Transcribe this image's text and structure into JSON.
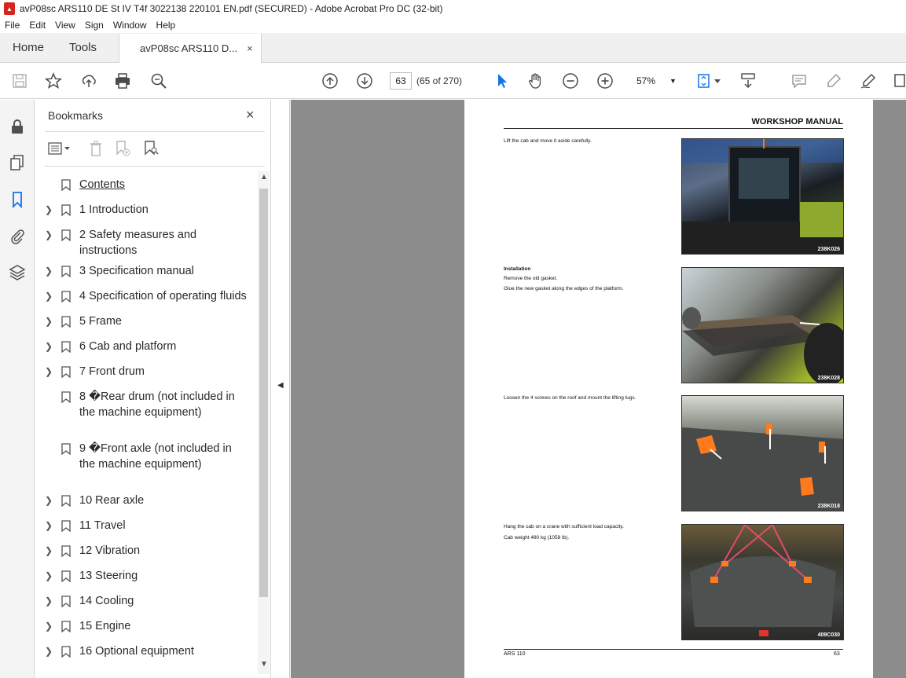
{
  "window": {
    "title": "avP08sc ARS110 DE St IV T4f 3022138 220101 EN.pdf (SECURED) - Adobe Acrobat Pro DC (32-bit)"
  },
  "menu": [
    "File",
    "Edit",
    "View",
    "Sign",
    "Window",
    "Help"
  ],
  "tabs": {
    "home": "Home",
    "tools": "Tools",
    "document": "avP08sc ARS110 D...",
    "close": "×"
  },
  "toolbar": {
    "page_number": "63",
    "page_count": "(65 of 270)",
    "zoom": "57%"
  },
  "bookmarks": {
    "title": "Bookmarks",
    "close": "×",
    "items": [
      {
        "label": "Contents",
        "expandable": false
      },
      {
        "label": "1 Introduction",
        "expandable": true
      },
      {
        "label": "2 Safety measures and instructions",
        "expandable": true
      },
      {
        "label": "3 Specification manual",
        "expandable": true
      },
      {
        "label": "4 Specification of operating fluids",
        "expandable": true
      },
      {
        "label": "5 Frame",
        "expandable": true
      },
      {
        "label": "6 Cab and platform",
        "expandable": true
      },
      {
        "label": "7 Front drum",
        "expandable": true
      },
      {
        "label": "8 �Rear drum (not included in the machine equipment)",
        "expandable": false
      },
      {
        "label": "9 �Front axle (not included in the machine equipment)",
        "expandable": false
      },
      {
        "label": "10 Rear axle",
        "expandable": true
      },
      {
        "label": "11 Travel",
        "expandable": true
      },
      {
        "label": "12 Vibration",
        "expandable": true
      },
      {
        "label": "13 Steering",
        "expandable": true
      },
      {
        "label": "14 Cooling",
        "expandable": true
      },
      {
        "label": "15 Engine",
        "expandable": true
      },
      {
        "label": "16 Optional equipment",
        "expandable": true
      }
    ]
  },
  "page": {
    "header": "WORKSHOP MANUAL",
    "blocks": [
      {
        "heading": "",
        "lines": [
          "Lift the cab and move it aside carefully."
        ],
        "caption": "238K026"
      },
      {
        "heading": "Installation",
        "lines": [
          "Remove the old gasket.",
          "Glue the new gasket along the edges of the platform."
        ],
        "caption": "238K028"
      },
      {
        "heading": "",
        "lines": [
          "Loosen the 4 screws on the roof and mount the lifting lugs."
        ],
        "caption": "238K018"
      },
      {
        "heading": "",
        "lines": [
          "Hang the cab on a crane with sufficient load capacity.",
          "Cab weight 480 kg (1058 lb)."
        ],
        "caption": "409C030"
      }
    ],
    "footer_left": "ARS 110",
    "footer_right": "63"
  }
}
